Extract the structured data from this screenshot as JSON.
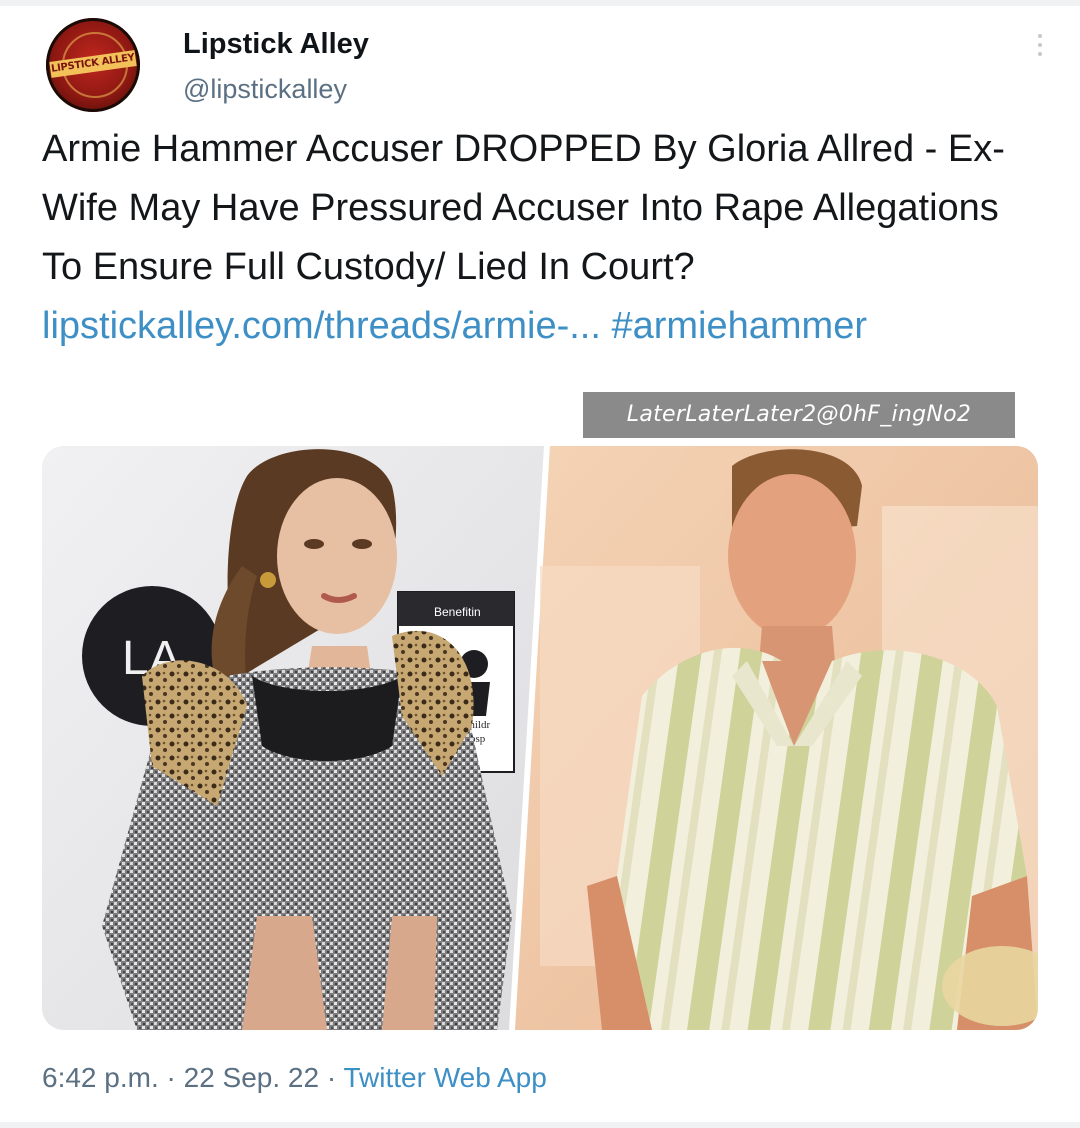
{
  "account": {
    "name": "Lipstick Alley",
    "handle": "@lipstickalley",
    "avatar_text": "LIPSTICK ALLEY"
  },
  "tweet": {
    "text": "Armie Hammer Accuser DROPPED By Gloria Allred - Ex-Wife May Have Pressured Accuser Into Rape Allegations To Ensure Full Custody/ Lied In Court?",
    "link": "lipstickalley.com/threads/armie-...",
    "hashtag": "#armiehammer"
  },
  "watermark": "LaterLaterLater2@0hF_ingNo2",
  "media": {
    "left_sign_text": "LA",
    "left_board_text": "Benefitin",
    "left_board_sub1": "Childr",
    "left_board_sub2": "Hosp"
  },
  "meta": {
    "time": "6:42 p.m.",
    "date": "22 Sep. 22",
    "source": "Twitter Web App",
    "separator": "·"
  },
  "colors": {
    "link": "#3d8fc6",
    "secondary_text": "#5b7083"
  },
  "icons": [
    "more-options-icon"
  ]
}
